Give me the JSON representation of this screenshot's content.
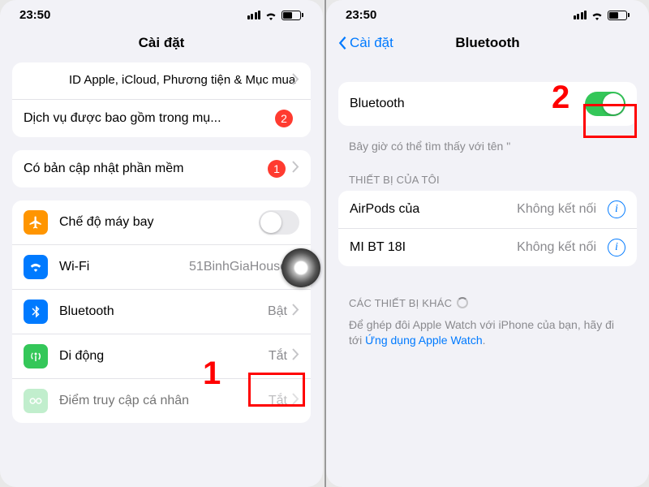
{
  "status": {
    "time": "23:50"
  },
  "left": {
    "title": "Cài đặt",
    "apple_id_line": "ID Apple, iCloud, Phương tiện & Mục mua",
    "included_services": "Dịch vụ được bao gồm trong mụ...",
    "included_badge": "2",
    "software_update": "Có bản cập nhật phần mềm",
    "software_badge": "1",
    "rows": {
      "airplane": "Chế độ máy bay",
      "wifi": "Wi-Fi",
      "wifi_val": "51BinhGiaHouse",
      "bluetooth": "Bluetooth",
      "bt_val": "Bật",
      "cellular": "Di động",
      "cell_val": "Tắt",
      "hotspot": "Điểm truy cập cá nhân",
      "hotspot_val": "Tắt"
    },
    "step_num": "1"
  },
  "right": {
    "back": "Cài đặt",
    "title": "Bluetooth",
    "toggle_label": "Bluetooth",
    "discoverable": "Bây giờ có thể tìm thấy với tên \"",
    "my_devices": "THIẾT BỊ CỦA TÔI",
    "dev1": "AirPods của",
    "dev1_status": "Không kết nối",
    "dev2": "MI BT 18I",
    "dev2_status": "Không kết nối",
    "other_devices": "CÁC THIẾT BỊ KHÁC",
    "watch_note_a": "Để ghép đôi Apple Watch với iPhone của bạn, hãy đi tới ",
    "watch_note_link": "Ứng dụng Apple Watch",
    "step_num": "2"
  }
}
